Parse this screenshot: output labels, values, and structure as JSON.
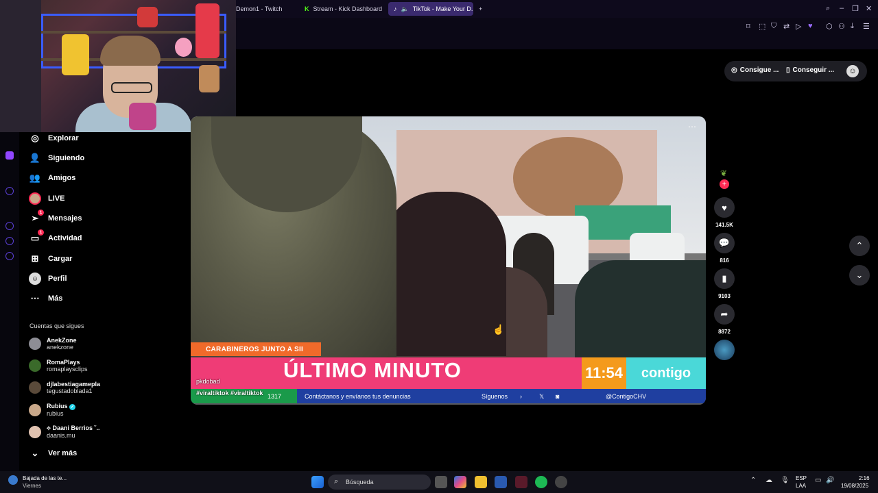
{
  "browser": {
    "tabs": [
      {
        "label": "Demon1 - Twitch"
      },
      {
        "label": "Stream - Kick Dashboard"
      },
      {
        "label": "TikTok - Make Your D..."
      }
    ],
    "new_tab": "+"
  },
  "sidebar": {
    "nav": [
      {
        "label": "Explorar",
        "icon": "compass-icon"
      },
      {
        "label": "Siguiendo",
        "icon": "person-follow-icon"
      },
      {
        "label": "Amigos",
        "icon": "friends-icon"
      },
      {
        "label": "LIVE",
        "icon": "live-avatar"
      },
      {
        "label": "Mensajes",
        "icon": "send-icon",
        "badge": "1"
      },
      {
        "label": "Actividad",
        "icon": "activity-icon",
        "badge": "1"
      },
      {
        "label": "Cargar",
        "icon": "upload-icon"
      },
      {
        "label": "Perfil",
        "icon": "profile-icon"
      },
      {
        "label": "Más",
        "icon": "more-icon"
      }
    ],
    "following_title": "Cuentas que sigues",
    "following": [
      {
        "name": "AnekZone",
        "handle": "anekzone"
      },
      {
        "name": "RomaPlays",
        "handle": "romaplaysclips"
      },
      {
        "name": "djlabestiagamepla",
        "handle": "tegustadoblada1"
      },
      {
        "name": "Rubius",
        "handle": "rubius"
      },
      {
        "name": "⟡ Daani Berrios ˘..",
        "handle": "daanis.mu"
      }
    ],
    "see_more": "Ver más"
  },
  "topright": {
    "btn1": "Consigue ...",
    "btn2": "Conseguir ..."
  },
  "video": {
    "banner_label": "CARABINEROS JUNTO A SII",
    "headline": "ÚLTIMO MINUTO",
    "clock": "11:54",
    "brand": "contigo",
    "ticker_number": "1317",
    "ticker_text": "Contáctanos y envíanos tus denuncias",
    "ticker_follow": "Síguenos",
    "ticker_handle": "@ContigoCHV",
    "author": "pkdobad",
    "tags": "#viraltiktok #viraltiktok"
  },
  "actions": {
    "likes": "141.5K",
    "comments": "816",
    "saves": "9103",
    "shares": "8872"
  },
  "taskbar": {
    "weather_title": "Bajada de las te...",
    "weather_sub": "Viernes",
    "search_placeholder": "Búsqueda",
    "lang": "ESP",
    "lang_sub": "LAA",
    "time": "2:16",
    "date": "19/08/2025"
  },
  "colors": {
    "accent": "#fe2c55",
    "lower_third": "#ef3c76",
    "clock_bg": "#f49a1c",
    "brand_bg": "#4ad8d8"
  }
}
